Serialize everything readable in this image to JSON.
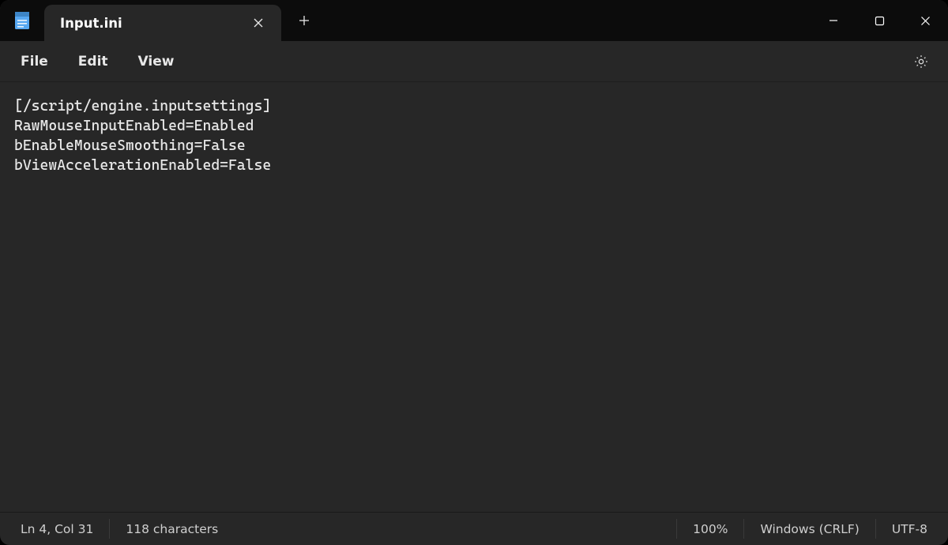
{
  "titlebar": {
    "tab_title": "Input.ini"
  },
  "menu": {
    "file": "File",
    "edit": "Edit",
    "view": "View"
  },
  "editor": {
    "content": "[/script/engine.inputsettings]\nRawMouseInputEnabled=Enabled\nbEnableMouseSmoothing=False\nbViewAccelerationEnabled=False"
  },
  "status": {
    "cursor": "Ln 4, Col 31",
    "characters": "118 characters",
    "zoom": "100%",
    "line_endings": "Windows (CRLF)",
    "encoding": "UTF-8"
  }
}
